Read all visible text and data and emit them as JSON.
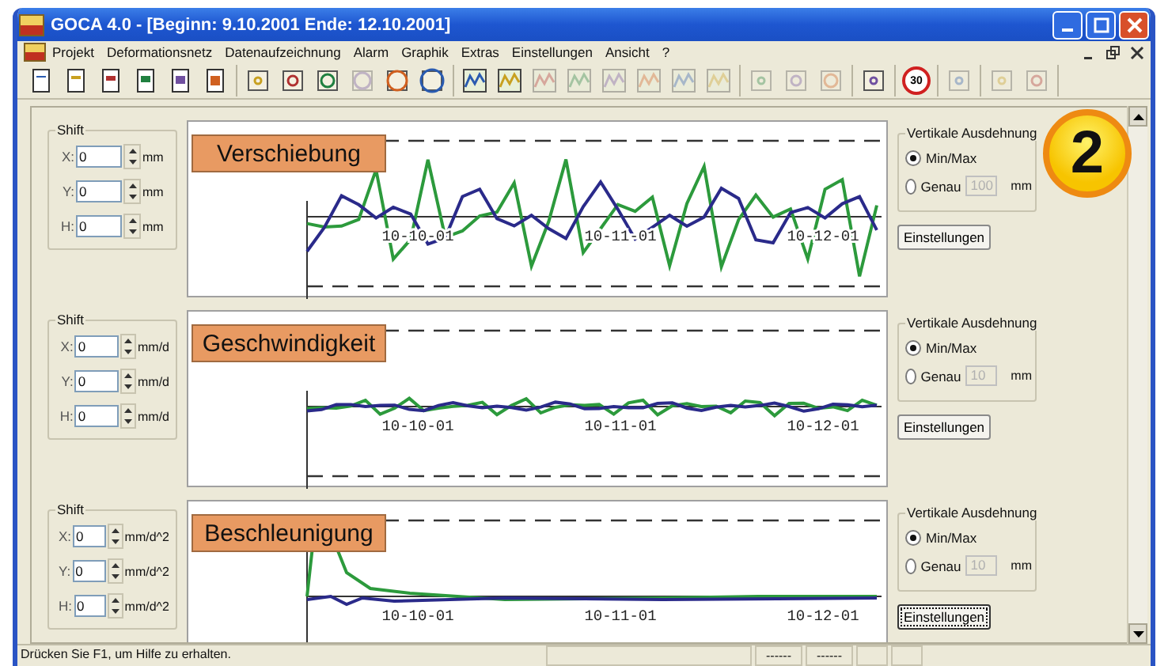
{
  "window": {
    "title": "GOCA 4.0 - [Beginn: 9.10.2001  Ende: 12.10.2001]"
  },
  "menu": [
    "Projekt",
    "Deformationsnetz",
    "Datenaufzeichnung",
    "Alarm",
    "Graphik",
    "Extras",
    "Einstellungen",
    "Ansicht",
    "?"
  ],
  "toolbar": [
    [
      {
        "disabled": false
      },
      {
        "disabled": false
      },
      {
        "disabled": false
      },
      {
        "disabled": false
      },
      {
        "disabled": false
      },
      {
        "disabled": false
      }
    ],
    [
      {
        "disabled": false
      },
      {
        "disabled": false
      },
      {
        "disabled": false
      },
      {
        "disabled": true
      },
      {
        "disabled": false
      },
      {
        "disabled": false
      }
    ],
    [
      {
        "disabled": false
      },
      {
        "disabled": false
      },
      {
        "disabled": true
      },
      {
        "disabled": true
      },
      {
        "disabled": true
      },
      {
        "disabled": true
      },
      {
        "disabled": true
      },
      {
        "disabled": true
      }
    ],
    [
      {
        "disabled": true
      },
      {
        "disabled": true
      },
      {
        "disabled": true
      }
    ],
    [
      {
        "disabled": false
      }
    ],
    [
      {
        "disabled": false,
        "text": "30"
      }
    ],
    [
      {
        "disabled": true
      }
    ],
    [
      {
        "disabled": true
      },
      {
        "disabled": true
      }
    ]
  ],
  "badge": "2",
  "sections": [
    {
      "shift_title": "Shift",
      "fields": [
        {
          "label": "X:",
          "value": "0",
          "unit": "mm"
        },
        {
          "label": "Y:",
          "value": "0",
          "unit": "mm"
        },
        {
          "label": "H:",
          "value": "0",
          "unit": "mm"
        }
      ],
      "chart_label": "Verschiebung",
      "dates": [
        "10-10-01",
        "10-11-01",
        "10-12-01"
      ],
      "range_title": "Vertikale Ausdehnung",
      "options": [
        {
          "label": "Min/Max",
          "selected": true
        },
        {
          "label": "Genau",
          "selected": false
        }
      ],
      "genau_value": "100",
      "genau_unit": "mm",
      "button": "Einstellungen",
      "focused": false
    },
    {
      "shift_title": "Shift",
      "fields": [
        {
          "label": "X:",
          "value": "0",
          "unit": "mm/d"
        },
        {
          "label": "Y:",
          "value": "0",
          "unit": "mm/d"
        },
        {
          "label": "H:",
          "value": "0",
          "unit": "mm/d"
        }
      ],
      "chart_label": "Geschwindigkeit",
      "dates": [
        "10-10-01",
        "10-11-01",
        "10-12-01"
      ],
      "range_title": "Vertikale Ausdehnung",
      "options": [
        {
          "label": "Min/Max",
          "selected": true
        },
        {
          "label": "Genau",
          "selected": false
        }
      ],
      "genau_value": "10",
      "genau_unit": "mm",
      "button": "Einstellungen",
      "focused": false
    },
    {
      "shift_title": "Shift",
      "fields": [
        {
          "label": "X:",
          "value": "0",
          "unit": "mm/d^2"
        },
        {
          "label": "Y:",
          "value": "0",
          "unit": "mm/d^2"
        },
        {
          "label": "H:",
          "value": "0",
          "unit": "mm/d^2"
        }
      ],
      "chart_label": "Beschleunigung",
      "dates": [
        "10-10-01",
        "10-11-01",
        "10-12-01"
      ],
      "range_title": "Vertikale Ausdehnung",
      "options": [
        {
          "label": "Min/Max",
          "selected": true
        },
        {
          "label": "Genau",
          "selected": false
        }
      ],
      "genau_value": "10",
      "genau_unit": "mm",
      "button": "Einstellungen",
      "focused": true
    }
  ],
  "status_bar": {
    "text": "Drücken Sie F1, um Hilfe zu erhalten.",
    "cells": [
      "------",
      "------"
    ]
  }
}
